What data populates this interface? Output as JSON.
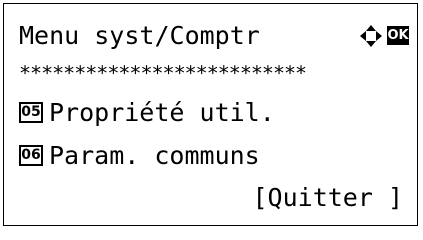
{
  "header": {
    "title": "Menu syst/Comptr",
    "nav_icon": "four-way-arrow-icon",
    "ok_label": "OK"
  },
  "progress_line": "∗∗∗∗∗∗∗∗∗∗∗∗∗∗∗∗∗∗∗∗∗∗∗∗∗∗",
  "menu": {
    "items": [
      {
        "number": "05",
        "label": "Propriété util."
      },
      {
        "number": "06",
        "label": "Param. communs"
      }
    ]
  },
  "softkey": {
    "quit_label": "[Quitter ]"
  }
}
